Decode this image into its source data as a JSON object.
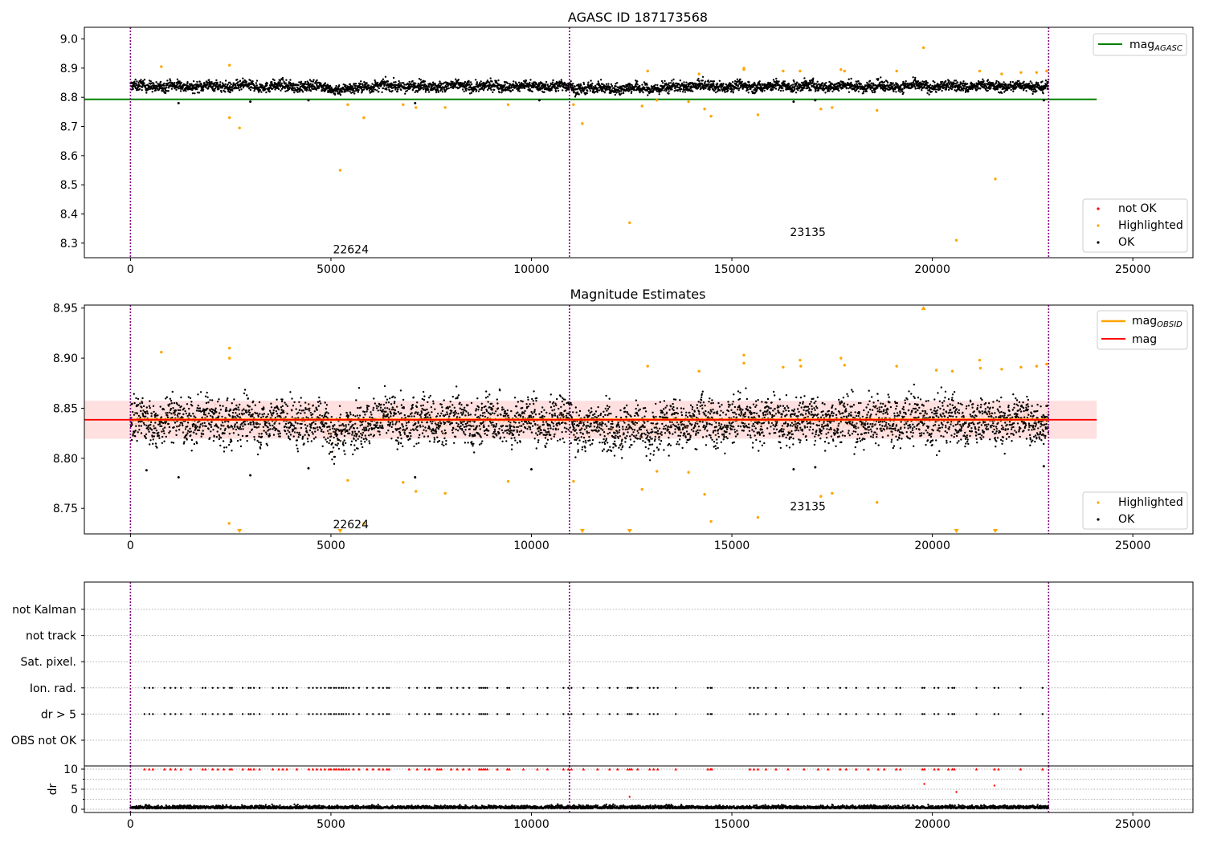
{
  "chart_data": [
    {
      "type": "scatter",
      "title": "AGASC ID 187173568",
      "xlim": [
        -1150,
        26500
      ],
      "ylim": [
        8.25,
        9.04
      ],
      "xticks": [
        0,
        5000,
        10000,
        15000,
        20000,
        25000
      ],
      "yticks": [
        8.3,
        8.4,
        8.5,
        8.6,
        8.7,
        8.8,
        8.9,
        9.0
      ],
      "grid": false,
      "observation_boundaries": [
        0,
        10950,
        22900
      ],
      "obsid_labels": [
        {
          "text": "22624",
          "x": 5050,
          "y": 8.265
        },
        {
          "text": "23135",
          "x": 16450,
          "y": 8.325
        }
      ],
      "lines": [
        {
          "name": "mag_AGASC",
          "color": "#008000",
          "y": 8.793,
          "x": [
            -1150,
            24100
          ]
        }
      ],
      "legend_top": {
        "placement": "top-right",
        "entries": [
          {
            "label": "mag",
            "sub": "AGASC",
            "kind": "line",
            "color": "#008000"
          }
        ]
      },
      "legend_bottom": {
        "placement": "lower-right",
        "entries": [
          {
            "label": "not OK",
            "kind": "marker",
            "color": "#ff0000"
          },
          {
            "label": "Highlighted",
            "kind": "marker",
            "color": "#ffa500"
          },
          {
            "label": "OK",
            "kind": "marker",
            "color": "#000000"
          }
        ]
      },
      "ok_band": {
        "x": [
          0,
          22900
        ],
        "center": 8.838,
        "spread": 0.027
      },
      "highlighted": [
        [
          770,
          8.905
        ],
        [
          2470,
          8.91
        ],
        [
          2470,
          8.73
        ],
        [
          2720,
          8.695
        ],
        [
          5230,
          8.55
        ],
        [
          5420,
          8.775
        ],
        [
          5820,
          8.73
        ],
        [
          6800,
          8.775
        ],
        [
          7120,
          8.765
        ],
        [
          7850,
          8.765
        ],
        [
          9420,
          8.775
        ],
        [
          11050,
          8.775
        ],
        [
          11270,
          8.71
        ],
        [
          12450,
          8.37
        ],
        [
          12760,
          8.77
        ],
        [
          12900,
          8.89
        ],
        [
          13130,
          8.79
        ],
        [
          13920,
          8.785
        ],
        [
          14180,
          8.88
        ],
        [
          14320,
          8.76
        ],
        [
          14480,
          8.735
        ],
        [
          15300,
          8.9
        ],
        [
          15300,
          8.895
        ],
        [
          15650,
          8.74
        ],
        [
          16280,
          8.89
        ],
        [
          16700,
          8.89
        ],
        [
          17220,
          8.76
        ],
        [
          17500,
          8.765
        ],
        [
          17720,
          8.895
        ],
        [
          17810,
          8.89
        ],
        [
          18620,
          8.755
        ],
        [
          19110,
          8.89
        ],
        [
          19780,
          8.97
        ],
        [
          20600,
          8.31
        ],
        [
          21180,
          8.89
        ],
        [
          21570,
          8.52
        ],
        [
          21730,
          8.88
        ],
        [
          22210,
          8.885
        ],
        [
          22600,
          8.885
        ],
        [
          22850,
          8.89
        ]
      ],
      "outliers_ok": [
        [
          1200,
          8.78
        ],
        [
          2990,
          8.785
        ],
        [
          4440,
          8.79
        ],
        [
          7100,
          8.78
        ],
        [
          10200,
          8.79
        ],
        [
          16540,
          8.785
        ],
        [
          17080,
          8.79
        ],
        [
          22780,
          8.79
        ]
      ]
    },
    {
      "type": "scatter",
      "title": "Magnitude Estimates",
      "xlim": [
        -1150,
        26500
      ],
      "ylim": [
        8.7245,
        8.953
      ],
      "xticks": [
        0,
        5000,
        10000,
        15000,
        20000,
        25000
      ],
      "yticks": [
        8.75,
        8.8,
        8.85,
        8.9,
        8.95
      ],
      "ytick_labels": [
        "8.75",
        "8.80",
        "8.85",
        "8.90",
        "8.95"
      ],
      "grid": false,
      "observation_boundaries": [
        0,
        10950,
        22900
      ],
      "obsid_labels": [
        {
          "text": "22624",
          "x": 5050,
          "y": 8.73
        },
        {
          "text": "23135",
          "x": 16450,
          "y": 8.748
        }
      ],
      "lines": [
        {
          "name": "mag_OBSID",
          "color": "#ffa500",
          "y": 8.8385,
          "x": [
            0,
            22900
          ]
        },
        {
          "name": "mag",
          "color": "#ff0000",
          "y": 8.8385,
          "x": [
            -1150,
            24100
          ]
        }
      ],
      "mag_band": {
        "y": [
          8.8195,
          8.8575
        ],
        "x": [
          -1150,
          24100
        ],
        "color": "#ffcccc"
      },
      "ok_band": {
        "x": [
          0,
          22900
        ],
        "center": 8.8375,
        "spread": 0.034
      },
      "legend_top": {
        "placement": "top-right",
        "entries": [
          {
            "label": "mag",
            "sub": "OBSID",
            "kind": "line",
            "color": "#ffa500"
          },
          {
            "label": "mag",
            "kind": "line",
            "color": "#ff0000"
          }
        ]
      },
      "legend_bottom": {
        "placement": "lower-right",
        "entries": [
          {
            "label": "Highlighted",
            "kind": "marker",
            "color": "#ffa500"
          },
          {
            "label": "OK",
            "kind": "marker",
            "color": "#000000"
          }
        ]
      },
      "highlighted": [
        [
          770,
          8.906
        ],
        [
          2470,
          8.91
        ],
        [
          2470,
          8.9
        ],
        [
          2460,
          8.735
        ],
        [
          5420,
          8.778
        ],
        [
          5820,
          8.735
        ],
        [
          6800,
          8.776
        ],
        [
          7120,
          8.767
        ],
        [
          7850,
          8.765
        ],
        [
          9420,
          8.777
        ],
        [
          11050,
          8.777
        ],
        [
          12760,
          8.769
        ],
        [
          12900,
          8.892
        ],
        [
          13130,
          8.787
        ],
        [
          13920,
          8.786
        ],
        [
          14180,
          8.887
        ],
        [
          14320,
          8.764
        ],
        [
          14480,
          8.737
        ],
        [
          15300,
          8.903
        ],
        [
          15300,
          8.895
        ],
        [
          15650,
          8.741
        ],
        [
          16280,
          8.891
        ],
        [
          16700,
          8.898
        ],
        [
          16720,
          8.892
        ],
        [
          17220,
          8.762
        ],
        [
          17500,
          8.765
        ],
        [
          17720,
          8.9
        ],
        [
          17810,
          8.893
        ],
        [
          18620,
          8.756
        ],
        [
          19110,
          8.892
        ],
        [
          20100,
          8.888
        ],
        [
          20500,
          8.887
        ],
        [
          21180,
          8.898
        ],
        [
          21200,
          8.89
        ],
        [
          21730,
          8.889
        ],
        [
          22210,
          8.891
        ],
        [
          22600,
          8.892
        ],
        [
          22850,
          8.894
        ]
      ],
      "clipped_low": [
        2720,
        5230,
        11270,
        12450,
        20600,
        21570
      ],
      "clipped_high": [
        19780
      ],
      "outliers_ok": [
        [
          1200,
          8.781
        ],
        [
          2990,
          8.783
        ],
        [
          4440,
          8.79
        ],
        [
          7100,
          8.781
        ],
        [
          10000,
          8.789
        ],
        [
          16540,
          8.789
        ],
        [
          17080,
          8.791
        ],
        [
          22780,
          8.792
        ],
        [
          400,
          8.788
        ]
      ]
    },
    {
      "type": "scatter",
      "title": "",
      "xlim": [
        -1150,
        26500
      ],
      "xticks": [
        0,
        5000,
        10000,
        15000,
        20000,
        25000
      ],
      "observation_boundaries": [
        0,
        10950,
        22900
      ],
      "flag_categories": [
        "not Kalman",
        "not track",
        "Sat. pixel.",
        "Ion. rad.",
        "dr > 5",
        "OBS not OK"
      ],
      "flag_events_x": [
        350,
        470,
        560,
        850,
        1000,
        1120,
        1260,
        1500,
        1800,
        1870,
        2050,
        2180,
        2330,
        2480,
        2530,
        2800,
        2950,
        3000,
        3080,
        3220,
        3550,
        3700,
        3800,
        3900,
        4150,
        4450,
        4550,
        4650,
        4750,
        4850,
        4950,
        5000,
        5080,
        5130,
        5200,
        5260,
        5310,
        5380,
        5450,
        5560,
        5700,
        5900,
        6050,
        6200,
        6300,
        6400,
        6450,
        6950,
        7150,
        7350,
        7450,
        7650,
        7700,
        7750,
        8000,
        8150,
        8300,
        8450,
        8700,
        8750,
        8800,
        8850,
        8900,
        9150,
        9400,
        9450,
        9800,
        10150,
        10400,
        10800,
        10920,
        11000,
        11300,
        11650,
        11950,
        12150,
        12400,
        12450,
        12500,
        12650,
        12950,
        13050,
        13150,
        13600,
        14400,
        14470,
        14500,
        15450,
        15550,
        15650,
        15850,
        16100,
        16400,
        16800,
        17150,
        17400,
        17700,
        17850,
        18100,
        18400,
        18650,
        18800,
        19100,
        19200,
        19750,
        19800,
        20050,
        20150,
        20400,
        20500,
        20550,
        21100,
        21550,
        21650,
        22200,
        22750
      ],
      "dr_ylim": [
        -0.8,
        10.8
      ],
      "dr_yticks": [
        0,
        5,
        10
      ],
      "dr_ylabel": "dr",
      "dr_clip": 10,
      "dr_spikes": [
        [
          12450,
          3.1
        ],
        [
          19800,
          6.3
        ],
        [
          20600,
          4.3
        ],
        [
          21550,
          5.9
        ]
      ]
    }
  ]
}
